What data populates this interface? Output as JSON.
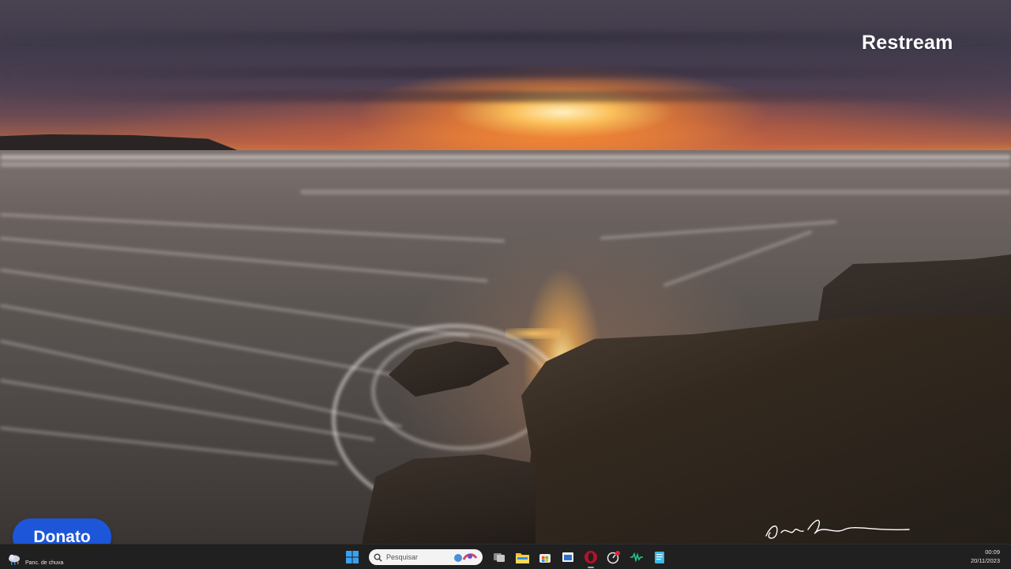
{
  "overlay": {
    "brand": "Restream",
    "donate_label": "Donato"
  },
  "taskbar": {
    "weather_label": "Panc. de chuva",
    "search_placeholder": "Pesquisar",
    "pinned_icons": [
      "windows-start",
      "search",
      "task-view",
      "file-explorer",
      "microsoft-store",
      "window-app",
      "opera",
      "chrome-like",
      "green-app",
      "notepad"
    ],
    "clock_time": "00:09",
    "clock_date": "20/11/2023"
  },
  "colors": {
    "donate_bg": "#1d56d8",
    "taskbar_bg": "#202020",
    "accent_sun": "#f5a442"
  }
}
